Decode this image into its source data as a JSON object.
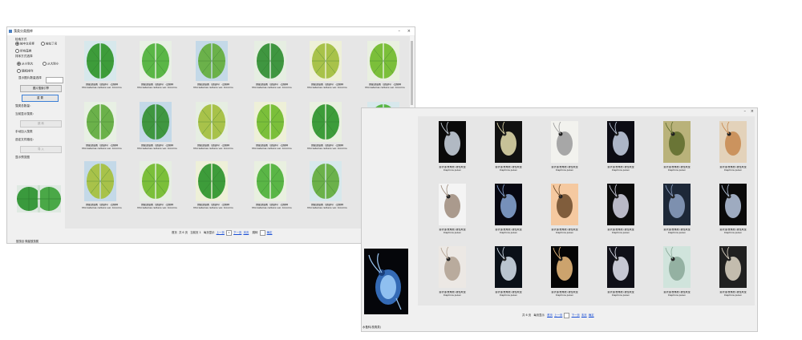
{
  "left_window": {
    "title": "藻类分类图库",
    "sidebar": {
      "heading": "检索方式",
      "radio_a": "按中文名称",
      "radio_b": "按拉丁名",
      "radio_c": "所有藻类",
      "sort_label": "排序方式选择",
      "sort_a": "从小到大",
      "sort_b": "从大到小",
      "sort_c": "随机排列",
      "filter_label": "显示图片数量选择",
      "btn_search": "图片搜索引擎",
      "btn_reset": "重  置",
      "label_total": "藻类总数量：",
      "label_current": "当前显示藻类：",
      "btn_go": "跳  转",
      "label_import": "手动加入藻类",
      "label_path": "选定文件路径：",
      "btn_import": "导  入",
      "label_preview": "显示预览图"
    },
    "status": "鼓藻目 微星鼓藻属",
    "caption_a": "微星鼓藻属（鼓藻科）-近缘种",
    "caption_b": "Micrasterias radians var. bicornis",
    "pager": {
      "first_label": "首页",
      "total_label": "共",
      "page_count": "6",
      "page_unit": "页",
      "current_label": "当前页",
      "current_page": "1",
      "perpage_label": "每页显示",
      "prev": "上一页",
      "next": "下一页",
      "last": "末页",
      "jump_label": "跳转",
      "jump_btn": "确定"
    }
  },
  "right_window": {
    "status": "水蚤科(枝角类)",
    "caption_top": "蚤状溞(枝角类)  雌性成虫",
    "caption_sub": "Daphnia pulex",
    "pager": {
      "total_label": "共",
      "page_count": "6",
      "page_unit": "页",
      "perpage_label": "每页显示",
      "prev": "上一页",
      "next": "下一页",
      "first": "首页",
      "last": "末页",
      "jump_btn": "确定"
    }
  }
}
